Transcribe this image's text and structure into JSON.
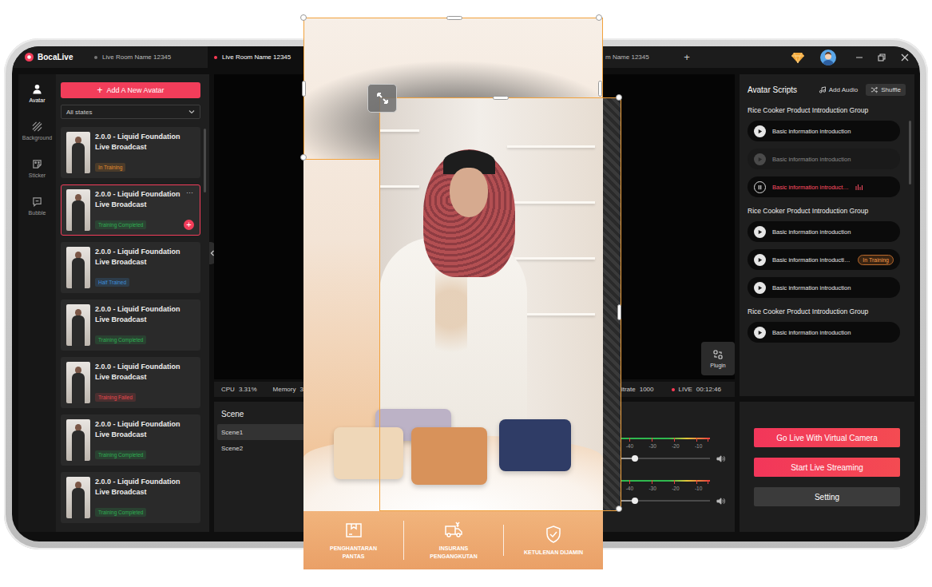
{
  "app": {
    "logo": "BocaLive"
  },
  "tabs": [
    {
      "label": "Live Room Name 12345",
      "selected": false
    },
    {
      "label": "Live Room Name 12345",
      "selected": true
    },
    {
      "label": "m Name 12345",
      "selected": false
    }
  ],
  "new_tab": "+",
  "rail": [
    {
      "label": "Avatar",
      "selected": true
    },
    {
      "label": "Background",
      "selected": false
    },
    {
      "label": "Sticker",
      "selected": false
    },
    {
      "label": "Bubble",
      "selected": false
    }
  ],
  "avatars": {
    "add_icon": "+",
    "add_button": "Add A New Avatar",
    "filter": "All states",
    "selected_menu": "···",
    "selected_add": "+",
    "items": [
      {
        "title": "2.0.0 - Liquid Foundation Live Broadcast",
        "status": "In Training",
        "color": "#e08a2e",
        "selected": false
      },
      {
        "title": "2.0.0 - Liquid Foundation Live Broadcast",
        "status": "Training Completed",
        "color": "#2fae52",
        "selected": true
      },
      {
        "title": "2.0.0 - Liquid Foundation Live Broadcast",
        "status": "Half Trained",
        "color": "#3e8fdb",
        "selected": false
      },
      {
        "title": "2.0.0 - Liquid Foundation Live Broadcast",
        "status": "Training Completed",
        "color": "#2fae52",
        "selected": false
      },
      {
        "title": "2.0.0 - Liquid Foundation Live Broadcast",
        "status": "Training Failed",
        "color": "#e5484d",
        "selected": false
      },
      {
        "title": "2.0.0 - Liquid Foundation Live Broadcast",
        "status": "Training Completed",
        "color": "#2fae52",
        "selected": false
      },
      {
        "title": "2.0.0 - Liquid Foundation Live Broadcast",
        "status": "Training Completed",
        "color": "#2fae52",
        "selected": false
      }
    ]
  },
  "plugin": "Plugin",
  "stats": {
    "cpu": {
      "label": "CPU",
      "value": "3.31%"
    },
    "memory": {
      "label": "Memory",
      "value": "3.3"
    },
    "bitrate": {
      "label": "Bitrate",
      "value": "1000"
    },
    "live": {
      "label": "LIVE",
      "value": "00:12:46"
    }
  },
  "scenes": {
    "title": "Scene",
    "items": [
      {
        "label": "Scene1",
        "selected": true
      },
      {
        "label": "Scene2",
        "selected": false
      }
    ]
  },
  "mixer": {
    "ticks": [
      "-40",
      "-30",
      "-20",
      "-10"
    ],
    "channels": [
      {
        "level": 0.18
      },
      {
        "level": 0.18
      }
    ]
  },
  "scripts": {
    "title": "Avatar Scripts",
    "add_audio": "Add Audio",
    "shuffle": "Shuffle",
    "groups": [
      {
        "title": "Rice Cooker Product Introduction Group",
        "items": [
          {
            "label": "Basic information introduction",
            "kind": "play"
          },
          {
            "label": "Basic information introduction",
            "kind": "disabled"
          },
          {
            "label": "Basic information introduct…",
            "kind": "playing"
          }
        ]
      },
      {
        "title": "Rice Cooker Product Introduction Group",
        "items": [
          {
            "label": "Basic information introduction",
            "kind": "play"
          },
          {
            "label": "Basic information introducti…",
            "kind": "play",
            "badge": "In Training"
          },
          {
            "label": "Basic information introduction",
            "kind": "play"
          }
        ]
      },
      {
        "title": "Rice Cooker Product Introduction Group",
        "items": [
          {
            "label": "Basic information introduction",
            "kind": "play"
          }
        ]
      }
    ]
  },
  "actions": [
    {
      "label": "Go Live With Virtual Camera",
      "kind": "primary"
    },
    {
      "label": "Start Live Streaming",
      "kind": "primary"
    },
    {
      "label": "Setting",
      "kind": "secondary"
    }
  ],
  "preview": {
    "badges": [
      "PENGHANTARAN PANTAS",
      "INSURANS PENGANGKUTAN",
      "KETULENAN DIJAMIN"
    ]
  }
}
